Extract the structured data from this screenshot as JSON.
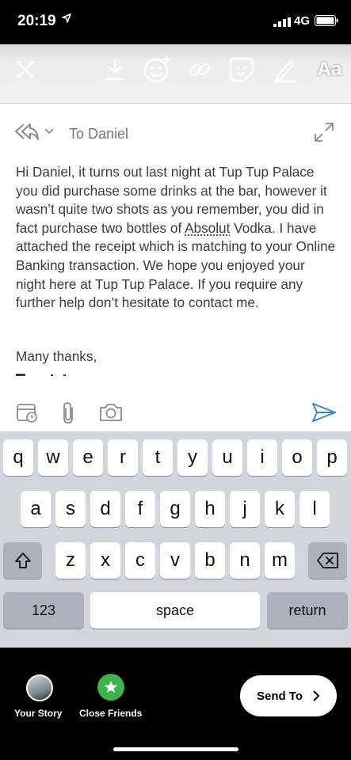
{
  "status_bar": {
    "time": "20:19",
    "network": "4G"
  },
  "story_tools": {
    "text_tool_label": "Aa",
    "icons": [
      "close-icon",
      "download-icon",
      "effects-face-icon",
      "link-icon",
      "sticker-icon",
      "pen-icon"
    ]
  },
  "compose": {
    "to_label": "To Daniel",
    "body_before": "Hi Daniel, it turns out last night at Tup Tup Palace you did purchase some drinks at the bar, however it wasn’t quite two shots as you remember, you did in fact purchase two bottles of ",
    "body_misspelled": "Absolut",
    "body_after": " Vodka. I have attached the receipt which is matching to your Online Banking transaction. We hope you enjoyed your night here at Tup Tup Palace. If you require any further help don’t hesitate to contact me.",
    "signoff": "Many thanks,"
  },
  "keyboard": {
    "row1": [
      "q",
      "w",
      "e",
      "r",
      "t",
      "y",
      "u",
      "i",
      "o",
      "p"
    ],
    "row2": [
      "a",
      "s",
      "d",
      "f",
      "g",
      "h",
      "j",
      "k",
      "l"
    ],
    "row3": [
      "z",
      "x",
      "c",
      "v",
      "b",
      "n",
      "m"
    ],
    "numbers_label": "123",
    "space_label": "space",
    "return_label": "return"
  },
  "bottom": {
    "your_story_label": "Your Story",
    "close_friends_label": "Close Friends",
    "send_to_label": "Send To"
  },
  "colors": {
    "accent_blue": "#3a86c8",
    "close_friends_green": "#3cb54a",
    "misspell_red": "#e02020"
  }
}
